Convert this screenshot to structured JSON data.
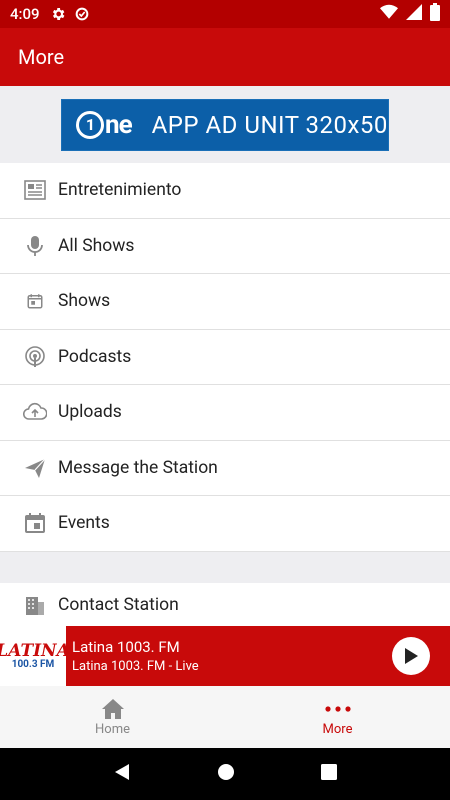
{
  "status_bar": {
    "time": "4:09"
  },
  "app_bar": {
    "title": "More"
  },
  "ad": {
    "logo_text": "ne",
    "logo_digit": "1",
    "text": "APP AD UNIT 320x50"
  },
  "menu": {
    "items": [
      {
        "label": "Entretenimiento",
        "icon": "newspaper-icon"
      },
      {
        "label": "All Shows",
        "icon": "microphone-icon"
      },
      {
        "label": "Shows",
        "icon": "calendar-small-icon"
      },
      {
        "label": "Podcasts",
        "icon": "podcast-icon"
      },
      {
        "label": "Uploads",
        "icon": "cloud-upload-icon"
      },
      {
        "label": "Message the Station",
        "icon": "send-icon"
      },
      {
        "label": "Events",
        "icon": "calendar-icon"
      }
    ],
    "contact_label": "Contact Station"
  },
  "player": {
    "logo_line1": "LATINA",
    "logo_line2": "100.3 FM",
    "title": "Latina 1003. FM",
    "subtitle": "Latina 1003. FM  - Live"
  },
  "bottom_nav": {
    "home_label": "Home",
    "more_label": "More",
    "active": "More",
    "active_color": "#c80a0a",
    "inactive_color": "#888888"
  },
  "colors": {
    "accent": "#c80a0a",
    "status": "#b30000",
    "ad_blue": "#0c5fa8"
  }
}
